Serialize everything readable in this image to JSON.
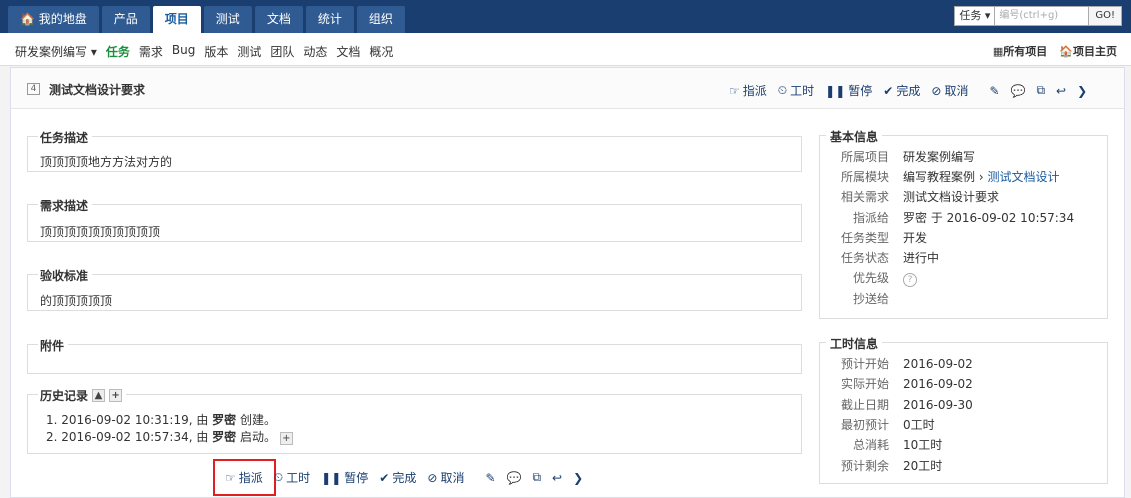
{
  "topnav": {
    "tabs": [
      {
        "label": "🏠 我的地盘"
      },
      {
        "label": "产品"
      },
      {
        "label": "项目"
      },
      {
        "label": "测试"
      },
      {
        "label": "文档"
      },
      {
        "label": "统计"
      },
      {
        "label": "组织"
      }
    ],
    "search": {
      "type": "任务 ▾",
      "placeholder": "编号(ctrl+g)",
      "go": "GO!"
    }
  },
  "subnav": {
    "project": "研发案例编写 ▾",
    "items": [
      "任务",
      "需求",
      "Bug",
      "版本",
      "测试",
      "团队",
      "动态",
      "文档",
      "概况"
    ],
    "right": [
      "▦所有项目",
      "🏠项目主页"
    ]
  },
  "task": {
    "id": "4",
    "title": "测试文档设计要求"
  },
  "actions": {
    "assign": "指派",
    "hours": "工时",
    "pause": "暂停",
    "finish": "完成",
    "cancel": "取消"
  },
  "sections": {
    "desc": {
      "title": "任务描述",
      "content": "顶顶顶顶地方方法对方的"
    },
    "story": {
      "title": "需求描述",
      "content": "顶顶顶顶顶顶顶顶顶顶"
    },
    "verify": {
      "title": "验收标准",
      "content": "的顶顶顶顶顶"
    },
    "files": {
      "title": "附件"
    },
    "history": {
      "title": "历史记录",
      "items": [
        {
          "prefix": "1. 2016-09-02 10:31:19, 由 ",
          "user": "罗密",
          "action": " 创建。"
        },
        {
          "prefix": "2. 2016-09-02 10:57:34, 由 ",
          "user": "罗密",
          "action": " 启动。"
        }
      ]
    }
  },
  "basic": {
    "title": "基本信息",
    "rows": {
      "project": {
        "k": "所属项目",
        "v": "研发案例编写"
      },
      "module": {
        "k": "所属模块",
        "v1": "编写教程案例 › ",
        "v2": "测试文档设计"
      },
      "story": {
        "k": "相关需求",
        "v": "测试文档设计要求"
      },
      "assigned": {
        "k": "指派给",
        "v": "罗密 于 2016-09-02 10:57:34"
      },
      "type": {
        "k": "任务类型",
        "v": "开发"
      },
      "status": {
        "k": "任务状态",
        "v": "进行中"
      },
      "pri": {
        "k": "优先级",
        "v": "?"
      },
      "cc": {
        "k": "抄送给",
        "v": ""
      }
    }
  },
  "effort": {
    "title": "工时信息",
    "rows": {
      "estStart": {
        "k": "预计开始",
        "v": "2016-09-02"
      },
      "realStart": {
        "k": "实际开始",
        "v": "2016-09-02"
      },
      "deadline": {
        "k": "截止日期",
        "v": "2016-09-30"
      },
      "estimate": {
        "k": "最初预计",
        "v": "0工时"
      },
      "consumed": {
        "k": "总消耗",
        "v": "10工时"
      },
      "left": {
        "k": "预计剩余",
        "v": "20工时"
      }
    }
  }
}
